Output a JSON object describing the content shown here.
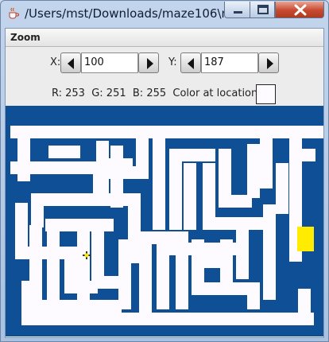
{
  "window": {
    "title": "/Users/mst/Downloads/maze106\\m...",
    "controls": [
      "minimize",
      "maximize",
      "close"
    ]
  },
  "menu": {
    "items": [
      "Zoom"
    ]
  },
  "position": {
    "x_label": "X:",
    "x_value": "100",
    "y_label": "Y:",
    "y_value": "187"
  },
  "color_info": {
    "text": "R: 253  G: 251  B: 255  Color at location:",
    "swatch_color": "#fdfbff"
  },
  "maze": {
    "wall_color": "#0e4f95",
    "path_color": "#fdfbff",
    "exit_color": "#ffec00"
  },
  "icons": {
    "app": "java-cup-icon",
    "left": "left-arrow-icon",
    "right": "right-arrow-icon",
    "cursor": "cursor-marker-icon"
  }
}
